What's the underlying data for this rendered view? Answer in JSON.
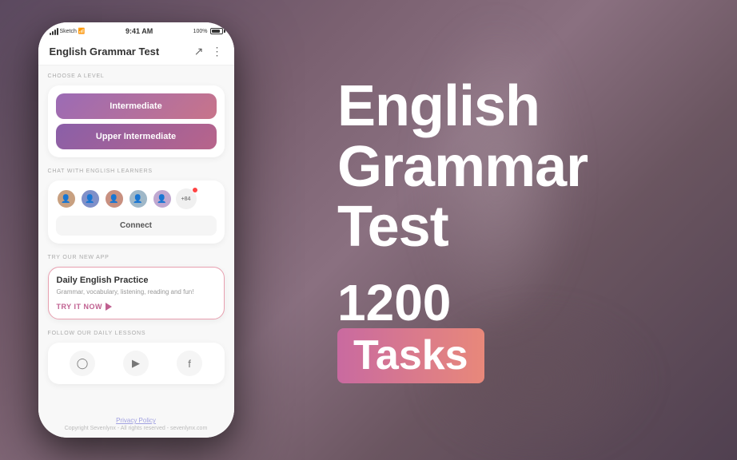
{
  "background": {
    "color": "#6b5a6e"
  },
  "phone": {
    "statusBar": {
      "carrier": "Sketch",
      "time": "9:41 AM",
      "battery": "100%"
    },
    "header": {
      "title": "English Grammar Test",
      "shareIcon": "share-icon",
      "menuIcon": "menu-icon"
    },
    "sections": {
      "chooseLevel": {
        "label": "CHOOSE A LEVEL",
        "buttons": [
          {
            "id": "intermediate",
            "label": "Intermediate"
          },
          {
            "id": "upper-intermediate",
            "label": "Upper Intermediate"
          }
        ]
      },
      "chat": {
        "label": "CHAT WITH ENGLISH LEARNERS",
        "avatarCount": "+84",
        "connectBtn": "Connect"
      },
      "tryApp": {
        "label": "TRY OUR NEW APP",
        "appName": "Daily English Practice",
        "appDesc": "Grammar, vocabulary, listening, reading and fun!",
        "tryBtn": "TRY IT NOW"
      },
      "social": {
        "label": "FOLLOW OUR DAILY LESSONS",
        "icons": [
          "instagram",
          "telegram",
          "facebook"
        ]
      }
    },
    "footer": {
      "privacyLink": "Privacy Policy",
      "copyright": "Copyright Sevenlynx - All rights reserved - sevenlynx.com"
    }
  },
  "rightPanel": {
    "title1": "English",
    "title2": "Grammar Test",
    "number": "1200",
    "tasksWord": "Tasks"
  }
}
